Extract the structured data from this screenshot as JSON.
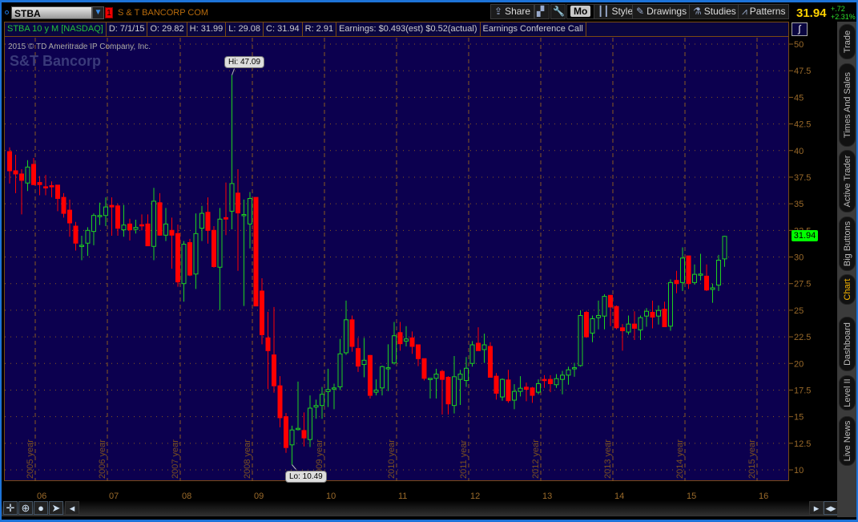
{
  "toolbar": {
    "symbol": "STBA",
    "link_number": "1",
    "company": "S & T BANCORP COM",
    "share": "Share",
    "mo": "Mo",
    "style": "Style",
    "drawings": "Drawings",
    "studies": "Studies",
    "patterns": "Patterns",
    "last_price": "31.94",
    "change": "+.72",
    "change_pct": "+2.31%"
  },
  "info": {
    "desc": "STBA 10 y M [NASDAQ]",
    "date": "D: 7/1/15",
    "open": "O: 29.82",
    "high": "H: 31.99",
    "low": "L: 29.08",
    "close": "C: 31.94",
    "range": "R: 2.91",
    "earnings": "Earnings: $0.493(est) $0.52(actual)",
    "conf": "Earnings Conference Call"
  },
  "copyright": "2015 © TD Ameritrade IP Company, Inc.",
  "logo": "S&T Bancorp",
  "sidebar": {
    "tabs": [
      "Trade",
      "Times And Sales",
      "Active Trader",
      "Big Buttons",
      "Chart",
      "Dashboard",
      "Level II",
      "Live News"
    ],
    "active": "Chart"
  },
  "colors": {
    "bg": "#0c004f",
    "up": "#1fd21f",
    "down": "#ff0000",
    "grid": "#8a5a1f"
  },
  "chart_data": {
    "type": "candlestick",
    "title": "STBA 10 y M [NASDAQ]",
    "ylim": [
      10,
      50
    ],
    "yticks": [
      "10",
      "12.5",
      "15",
      "17.5",
      "20",
      "22.5",
      "25",
      "27.5",
      "30",
      "32.5",
      "35",
      "37.5",
      "40",
      "42.5",
      "45",
      "47.5",
      "50"
    ],
    "xtick_labels": [
      "06",
      "07",
      "08",
      "09",
      "10",
      "11",
      "12",
      "13",
      "14",
      "15",
      "16"
    ],
    "year_labels": [
      "2005 year",
      "2006 year",
      "2007 year",
      "2008 year",
      "2009 year",
      "2010 year",
      "2011 year",
      "2012 year",
      "2013 year",
      "2014 year",
      "2015 year"
    ],
    "start": "2005-09",
    "interval": "month",
    "hi_label": "Hi: 47.09",
    "lo_label": "Lo: 10.49",
    "last_label": "31.94",
    "ohlc": [
      [
        39.9,
        40.3,
        36.9,
        38.1
      ],
      [
        38.1,
        39.6,
        36.0,
        37.8
      ],
      [
        37.8,
        38.25,
        34.0,
        37.2
      ],
      [
        36.95,
        39.1,
        36.2,
        38.45
      ],
      [
        38.7,
        39.3,
        36.75,
        36.8
      ],
      [
        37.0,
        37.6,
        35.8,
        36.8
      ],
      [
        36.6,
        37.7,
        35.8,
        36.5
      ],
      [
        36.7,
        37.1,
        35.6,
        36.6
      ],
      [
        36.75,
        36.75,
        34.3,
        35.5
      ],
      [
        35.6,
        36.0,
        33.7,
        34.1
      ],
      [
        34.4,
        35.4,
        31.9,
        33.2
      ],
      [
        32.9,
        33.3,
        30.6,
        31.3
      ],
      [
        31.05,
        32.0,
        29.7,
        31.1
      ],
      [
        31.3,
        32.8,
        30.1,
        32.5
      ],
      [
        32.4,
        34.1,
        31.1,
        33.9
      ],
      [
        33.85,
        35.1,
        33.0,
        33.9
      ],
      [
        33.9,
        35.6,
        32.9,
        34.7
      ],
      [
        34.85,
        35.6,
        32.0,
        34.7
      ],
      [
        34.8,
        35.0,
        32.0,
        32.7
      ],
      [
        32.55,
        34.9,
        31.9,
        33.0
      ],
      [
        33.1,
        33.6,
        31.55,
        32.55
      ],
      [
        32.6,
        33.5,
        32.2,
        32.78
      ],
      [
        33.03,
        34.0,
        32.5,
        32.96
      ],
      [
        33.1,
        34.0,
        31.05,
        31.05
      ],
      [
        31.0,
        36.5,
        29.7,
        35.24
      ],
      [
        35.1,
        36.0,
        32.0,
        32.05
      ],
      [
        32.05,
        34.6,
        31.5,
        33.1
      ],
      [
        32.5,
        33.7,
        28.9,
        32.05
      ],
      [
        32.2,
        33.05,
        27.2,
        27.66
      ],
      [
        27.5,
        31.5,
        25.8,
        31.2
      ],
      [
        31.35,
        31.7,
        28.2,
        28.3
      ],
      [
        28.4,
        34.1,
        27.0,
        32.2
      ],
      [
        32.7,
        34.8,
        31.5,
        34.1
      ],
      [
        34.2,
        35.6,
        31.25,
        32.5
      ],
      [
        32.5,
        32.9,
        29.0,
        29.1
      ],
      [
        29.04,
        34.6,
        25.0,
        33.56
      ],
      [
        33.7,
        37.0,
        32.05,
        33.56
      ],
      [
        34.3,
        47.09,
        32.6,
        36.9
      ],
      [
        36.0,
        38.25,
        28.7,
        34.14
      ],
      [
        33.89,
        35.4,
        25.4,
        33.99
      ],
      [
        33.1,
        36.1,
        30.8,
        35.5
      ],
      [
        35.6,
        35.6,
        25.4,
        25.4
      ],
      [
        26.8,
        28.0,
        21.8,
        22.7
      ],
      [
        22.4,
        24.85,
        17.6,
        21.2
      ],
      [
        20.8,
        25.3,
        17.25,
        17.9
      ],
      [
        17.9,
        18.8,
        14.0,
        14.9
      ],
      [
        15.0,
        15.35,
        11.6,
        12.1
      ],
      [
        12.35,
        14.15,
        10.49,
        13.75
      ],
      [
        13.9,
        18.3,
        13.7,
        13.9
      ],
      [
        13.7,
        15.4,
        12.2,
        13.0
      ],
      [
        12.85,
        17.0,
        12.15,
        15.8
      ],
      [
        15.9,
        16.6,
        14.8,
        16.05
      ],
      [
        16.05,
        17.8,
        14.8,
        17.1
      ],
      [
        17.35,
        19.5,
        15.9,
        17.55
      ],
      [
        17.7,
        18.1,
        15.7,
        17.7
      ],
      [
        17.8,
        22.3,
        17.5,
        20.9
      ],
      [
        21.0,
        25.9,
        20.8,
        24.1
      ],
      [
        24.1,
        24.5,
        21.1,
        21.6
      ],
      [
        21.4,
        22.4,
        19.2,
        19.75
      ],
      [
        19.9,
        22.4,
        18.7,
        20.3
      ],
      [
        20.75,
        20.8,
        16.7,
        17.0
      ],
      [
        17.3,
        18.5,
        17.0,
        17.5
      ],
      [
        17.7,
        19.8,
        17.0,
        19.7
      ],
      [
        19.5,
        21.8,
        17.4,
        19.6
      ],
      [
        20.05,
        23.9,
        19.9,
        22.6
      ],
      [
        22.9,
        23.9,
        21.2,
        21.85
      ],
      [
        22.1,
        23.5,
        21.6,
        22.3
      ],
      [
        22.4,
        23.0,
        20.9,
        21.6
      ],
      [
        21.75,
        21.75,
        19.75,
        20.45
      ],
      [
        20.45,
        20.45,
        18.4,
        18.6
      ],
      [
        18.5,
        18.6,
        16.7,
        18.6
      ],
      [
        18.6,
        19.5,
        16.7,
        19.0
      ],
      [
        19.25,
        19.4,
        15.2,
        18.5
      ],
      [
        18.7,
        18.8,
        15.2,
        16.2
      ],
      [
        16.05,
        20.7,
        15.3,
        18.75
      ],
      [
        18.5,
        19.4,
        16.1,
        19.0
      ],
      [
        18.4,
        20.6,
        17.8,
        19.55
      ],
      [
        20.0,
        22.1,
        19.7,
        21.75
      ],
      [
        21.9,
        23.4,
        21.2,
        21.2
      ],
      [
        21.3,
        22.8,
        20.05,
        21.75
      ],
      [
        21.6,
        22.0,
        18.7,
        18.7
      ],
      [
        18.8,
        19.1,
        16.6,
        17.2
      ],
      [
        16.85,
        18.6,
        16.5,
        18.5
      ],
      [
        18.45,
        19.4,
        16.3,
        16.5
      ],
      [
        16.55,
        18.05,
        15.7,
        17.37
      ],
      [
        17.37,
        18.8,
        16.9,
        17.67
      ],
      [
        17.77,
        18.2,
        16.45,
        17.57
      ],
      [
        17.7,
        17.8,
        16.3,
        17.0
      ],
      [
        17.3,
        18.5,
        17.1,
        18.1
      ],
      [
        18.5,
        18.9,
        17.7,
        18.45
      ],
      [
        18.5,
        18.9,
        17.3,
        18.1
      ],
      [
        18.0,
        19.0,
        17.7,
        18.57
      ],
      [
        18.5,
        19.3,
        17.1,
        18.9
      ],
      [
        18.9,
        19.7,
        18.0,
        19.4
      ],
      [
        19.5,
        20.06,
        18.75,
        19.6
      ],
      [
        19.8,
        25.0,
        19.7,
        24.5
      ],
      [
        24.8,
        24.95,
        22.4,
        22.5
      ],
      [
        22.85,
        24.5,
        22.0,
        24.2
      ],
      [
        24.3,
        25.9,
        23.2,
        24.5
      ],
      [
        24.45,
        26.5,
        23.2,
        26.3
      ],
      [
        26.4,
        26.4,
        23.5,
        25.3
      ],
      [
        25.35,
        25.45,
        23.2,
        23.35
      ],
      [
        23.35,
        23.7,
        21.2,
        23.07
      ],
      [
        22.95,
        24.5,
        22.7,
        23.7
      ],
      [
        23.7,
        24.9,
        22.2,
        23.3
      ],
      [
        23.15,
        24.5,
        22.2,
        24.3
      ],
      [
        24.45,
        25.2,
        23.45,
        24.9
      ],
      [
        24.8,
        25.9,
        23.3,
        24.35
      ],
      [
        24.45,
        25.45,
        23.65,
        24.98
      ],
      [
        25.1,
        25.8,
        23.45,
        23.45
      ],
      [
        23.5,
        27.9,
        23.07,
        27.6
      ],
      [
        27.8,
        28.7,
        26.6,
        27.5
      ],
      [
        27.6,
        30.9,
        26.8,
        29.9
      ],
      [
        30.1,
        30.1,
        27.0,
        27.5
      ],
      [
        27.6,
        29.3,
        27.4,
        28.37
      ],
      [
        28.4,
        30.3,
        27.8,
        28.4
      ],
      [
        28.2,
        29.3,
        26.8,
        26.9
      ],
      [
        26.95,
        27.5,
        25.7,
        27.1
      ],
      [
        27.36,
        30.2,
        26.8,
        29.7
      ],
      [
        29.82,
        31.99,
        29.08,
        31.94
      ]
    ]
  }
}
